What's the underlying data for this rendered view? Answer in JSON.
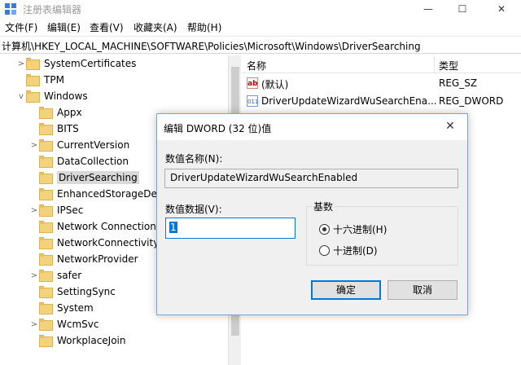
{
  "window": {
    "title": "注册表编辑器",
    "minimize_glyph": "—",
    "maximize_glyph": "☐",
    "close_glyph": "✕"
  },
  "menu": [
    "文件(F)",
    "编辑(E)",
    "查看(V)",
    "收藏夹(A)",
    "帮助(H)"
  ],
  "address": "计算机\\HKEY_LOCAL_MACHINE\\SOFTWARE\\Policies\\Microsoft\\Windows\\DriverSearching",
  "tree": [
    {
      "label": "SystemCertificates",
      "level": 1,
      "arrow": ">"
    },
    {
      "label": "TPM",
      "level": 1,
      "arrow": ""
    },
    {
      "label": "Windows",
      "level": 1,
      "arrow": "v"
    },
    {
      "label": "Appx",
      "level": 2,
      "arrow": ""
    },
    {
      "label": "BITS",
      "level": 2,
      "arrow": ""
    },
    {
      "label": "CurrentVersion",
      "level": 2,
      "arrow": ">"
    },
    {
      "label": "DataCollection",
      "level": 2,
      "arrow": ""
    },
    {
      "label": "DriverSearching",
      "level": 2,
      "arrow": "",
      "selected": true
    },
    {
      "label": "EnhancedStorageDevi",
      "level": 2,
      "arrow": ""
    },
    {
      "label": "IPSec",
      "level": 2,
      "arrow": ">"
    },
    {
      "label": "Network Connections",
      "level": 2,
      "arrow": ""
    },
    {
      "label": "NetworkConnectivityS",
      "level": 2,
      "arrow": ""
    },
    {
      "label": "NetworkProvider",
      "level": 2,
      "arrow": ""
    },
    {
      "label": "safer",
      "level": 2,
      "arrow": ">"
    },
    {
      "label": "SettingSync",
      "level": 2,
      "arrow": ""
    },
    {
      "label": "System",
      "level": 2,
      "arrow": ""
    },
    {
      "label": "WcmSvc",
      "level": 2,
      "arrow": ">"
    },
    {
      "label": "WorkplaceJoin",
      "level": 2,
      "arrow": ""
    }
  ],
  "list": {
    "headers": {
      "name": "名称",
      "type": "类型"
    },
    "rows": [
      {
        "icon": "ab",
        "name": "(默认)",
        "type": "REG_SZ"
      },
      {
        "icon": "bin",
        "name": "DriverUpdateWizardWuSearchEna...",
        "type": "REG_DWORD"
      }
    ]
  },
  "dialog": {
    "title": "编辑 DWORD (32 位)值",
    "close_glyph": "✕",
    "value_name_label": "数值名称(N):",
    "value_name": "DriverUpdateWizardWuSearchEnabled",
    "value_data_label": "数值数据(V):",
    "value_data": "1",
    "base_label": "基数",
    "base_options": [
      {
        "label": "十六进制(H)",
        "checked": true
      },
      {
        "label": "十进制(D)",
        "checked": false
      }
    ],
    "ok_label": "确定",
    "cancel_label": "取消"
  }
}
